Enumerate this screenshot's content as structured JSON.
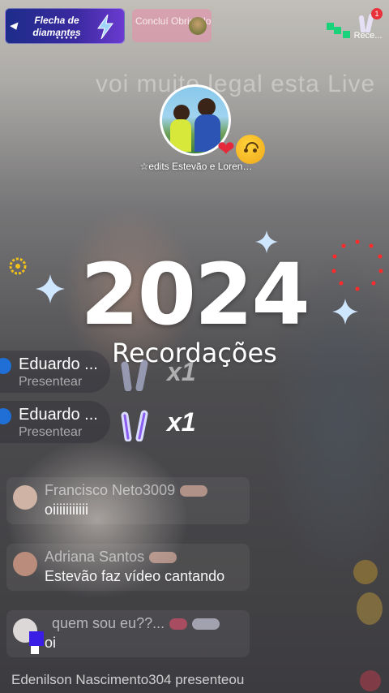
{
  "top": {
    "promo_diamond": "Flecha de diamantes",
    "promo_pink": "Concluí Obrigado",
    "rank_badge": "1",
    "rank_label": "Rece..."
  },
  "overlay_text": "voi muito legal esta Live",
  "host": {
    "name": "☆edits Estevão e Loren…"
  },
  "title": {
    "year": "2024",
    "subtitle": "Recordações"
  },
  "gifts": [
    {
      "name": "Eduardo ...",
      "sub": "Presentear",
      "count": "x1"
    },
    {
      "name": "Eduardo ...",
      "sub": "Presentear",
      "count": "x1"
    }
  ],
  "comments": [
    {
      "name": "Francisco Neto3009",
      "message": "oiiiiiiiiiii"
    },
    {
      "name": "Adriana Santos",
      "message": "Estevão faz vídeo cantando"
    },
    {
      "name": "quem  sou eu??...",
      "message": "oi"
    }
  ],
  "last_event": "Edenilson Nascimento304 presenteou",
  "colors": {
    "gift_dot": "#1f6fd6",
    "heart": "#e42a3a",
    "green": "#19d27a"
  }
}
